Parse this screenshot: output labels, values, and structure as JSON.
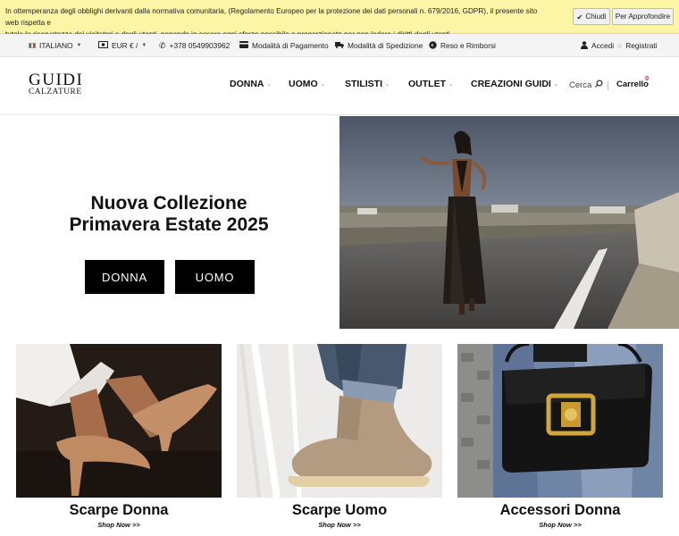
{
  "cookie": {
    "line1": "In ottemperanza degli obblighi derivanti dalla normativa comunitaria, (Regolamento Europeo per la protezione dei dati personali n. 679/2016, GDPR), il presente sito web rispetta e",
    "line2": "tutela la riservatezza dei visitatori e degli utenti, ponendo in essere ogni sforzo possibile e proporzionato per non ledere i diritti degli utenti.",
    "close_label": "Chiudi",
    "more_label": "Per Approfondire"
  },
  "topbar": {
    "language": "ITALIANO",
    "currency": "EUR € /",
    "phone": "+378 0549903962",
    "payment": "Modalità di Pagamento",
    "shipping": "Modalità di Spedizione",
    "returns": "Reso e Rimborsi",
    "login": "Accedi",
    "register": "Registrati"
  },
  "header": {
    "logo_main": "GUIDI",
    "logo_sub": "CALZATURE",
    "nav": [
      "DONNA",
      "UOMO",
      "STILISTI",
      "OUTLET",
      "CREAZIONI GUIDI"
    ],
    "search_label": "Cerca",
    "cart_label": "Carrello",
    "cart_count": "0"
  },
  "hero": {
    "title_line1": "Nuova Collezione",
    "title_line2": "Primavera Estate 2025",
    "btn_donna": "DONNA",
    "btn_uomo": "UOMO"
  },
  "cards": [
    {
      "title": "Scarpe Donna",
      "cta": "Shop Now >>"
    },
    {
      "title": "Scarpe Uomo",
      "cta": "Shop Now >>"
    },
    {
      "title": "Accessori Donna",
      "cta": "Shop Now >>"
    }
  ],
  "colors": {
    "cookie_bg": "#fdf5a6",
    "topbar_bg": "#f4f4f4",
    "button_black": "#000000",
    "cart_badge": "#dd2222"
  },
  "icons": [
    "flag-italy-icon",
    "currency-icon",
    "phone-icon",
    "card-icon",
    "truck-icon",
    "return-icon",
    "user-icon",
    "search-icon",
    "check-icon"
  ]
}
